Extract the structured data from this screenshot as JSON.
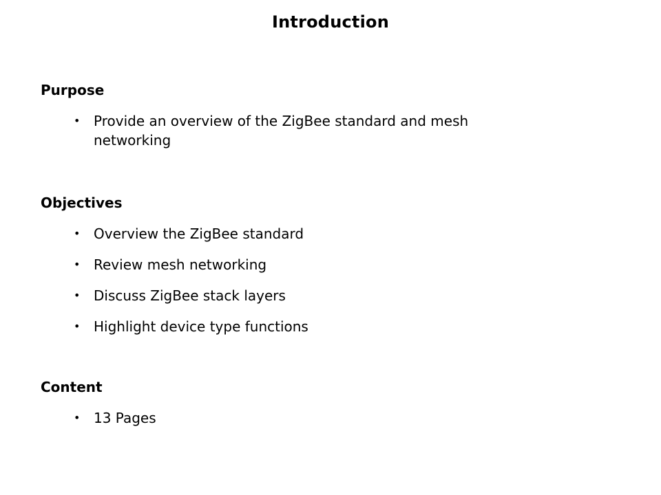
{
  "slide": {
    "title": "Introduction",
    "sections": [
      {
        "heading": "Purpose",
        "bullets": [
          "Provide an overview of the ZigBee standard and mesh networking"
        ]
      },
      {
        "heading": "Objectives",
        "bullets": [
          "Overview the ZigBee standard",
          "Review mesh networking",
          "Discuss ZigBee stack layers",
          "Highlight device type functions"
        ]
      },
      {
        "heading": "Content",
        "bullets": [
          "13 Pages"
        ]
      }
    ],
    "bullet_glyph": "•"
  }
}
